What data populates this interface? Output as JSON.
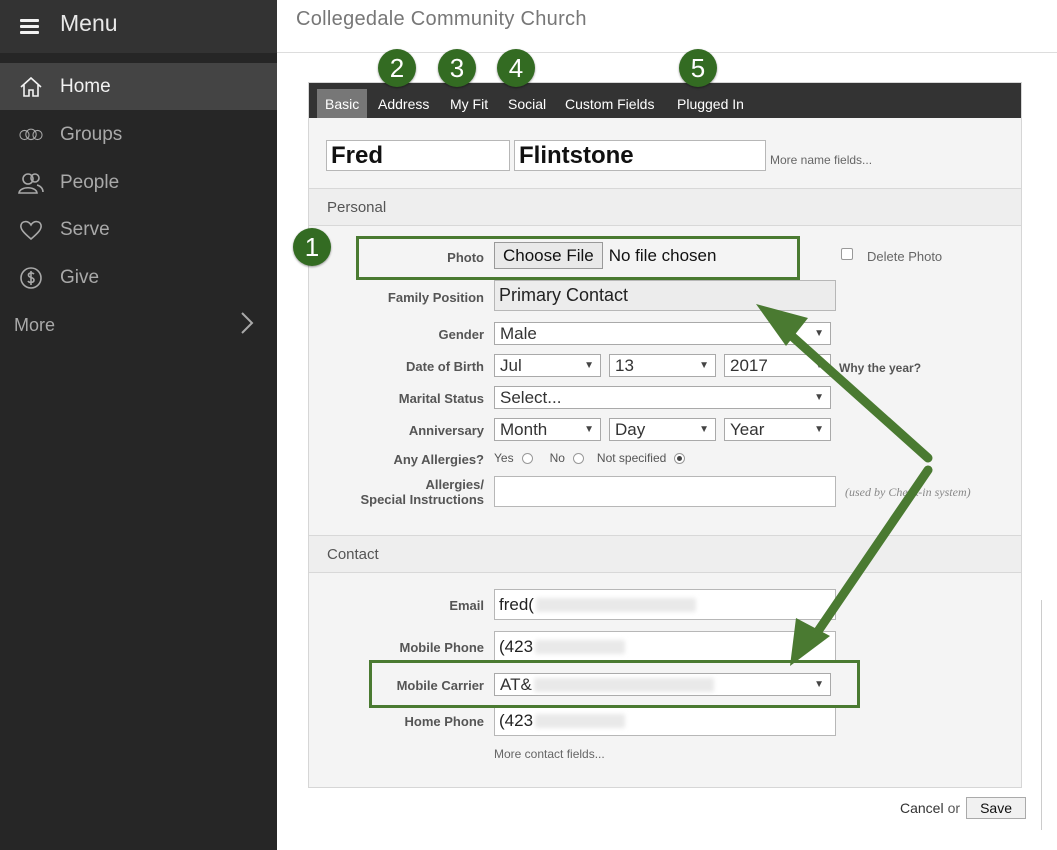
{
  "sidebar": {
    "menu_label": "Menu",
    "items": [
      {
        "label": "Home",
        "icon": "home-icon"
      },
      {
        "label": "Groups",
        "icon": "groups-icon"
      },
      {
        "label": "People",
        "icon": "people-icon"
      },
      {
        "label": "Serve",
        "icon": "heart-icon"
      },
      {
        "label": "Give",
        "icon": "dollar-icon"
      }
    ],
    "more_label": "More"
  },
  "header": {
    "title": "Collegedale Community Church"
  },
  "tabs": [
    "Basic",
    "Address",
    "My Fit",
    "Social",
    "Custom Fields",
    "Plugged In"
  ],
  "name": {
    "first": "Fred",
    "last": "Flintstone",
    "more_link": "More name fields..."
  },
  "personal": {
    "section_label": "Personal",
    "photo_label": "Photo",
    "choose_file": "Choose File",
    "no_file": "No file chosen",
    "delete_photo": "Delete Photo",
    "family_position_label": "Family Position",
    "family_position": "Primary Contact",
    "gender_label": "Gender",
    "gender": "Male",
    "dob_label": "Date of Birth",
    "dob_month": "Jul",
    "dob_day": "13",
    "dob_year": "2017",
    "why_year": "Why the year?",
    "marital_label": "Marital Status",
    "marital": "Select...",
    "anniversary_label": "Anniversary",
    "ann_month": "Month",
    "ann_day": "Day",
    "ann_year": "Year",
    "allergies_label": "Any Allergies?",
    "allergy_yes": "Yes",
    "allergy_no": "No",
    "allergy_ns": "Not specified",
    "allergies_instr_label_1": "Allergies/",
    "allergies_instr_label_2": "Special Instructions",
    "checkin_note": "(used by Check-in system)"
  },
  "contact": {
    "section_label": "Contact",
    "email_label": "Email",
    "email": "fred(",
    "mobile_label": "Mobile Phone",
    "mobile": "(423",
    "carrier_label": "Mobile Carrier",
    "carrier": "AT&",
    "home_label": "Home Phone",
    "home": "(423",
    "more_link": "More contact fields..."
  },
  "callouts": [
    "1",
    "2",
    "3",
    "4",
    "5"
  ],
  "footer": {
    "cancel": "Cancel",
    "or": "or",
    "save": "Save"
  },
  "colors": {
    "annotation_green": "#336b22",
    "sidebar_bg": "#262626",
    "tab_bar": "#333333"
  }
}
